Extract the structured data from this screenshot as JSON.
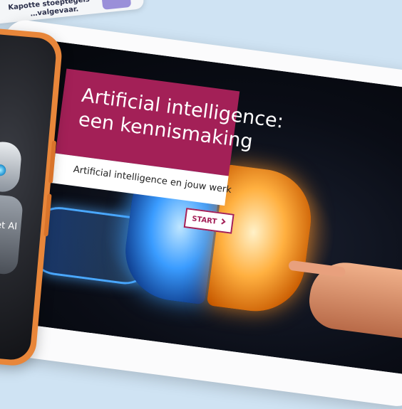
{
  "notification": {
    "line1": "Kapotte stoeptegels",
    "line2": "…valgevaar."
  },
  "course": {
    "title_line1": "Artificial intelligence:",
    "title_line2": "een kennismaking",
    "subtitle": "Artificial intelligence en jouw werk",
    "start_label": "START",
    "start_icon": "chevron-right-icon"
  },
  "phone": {
    "caption": "met AI"
  },
  "colors": {
    "accent": "#a32057",
    "phone_frame": "#e8863a",
    "background": "#cfe3f3"
  }
}
